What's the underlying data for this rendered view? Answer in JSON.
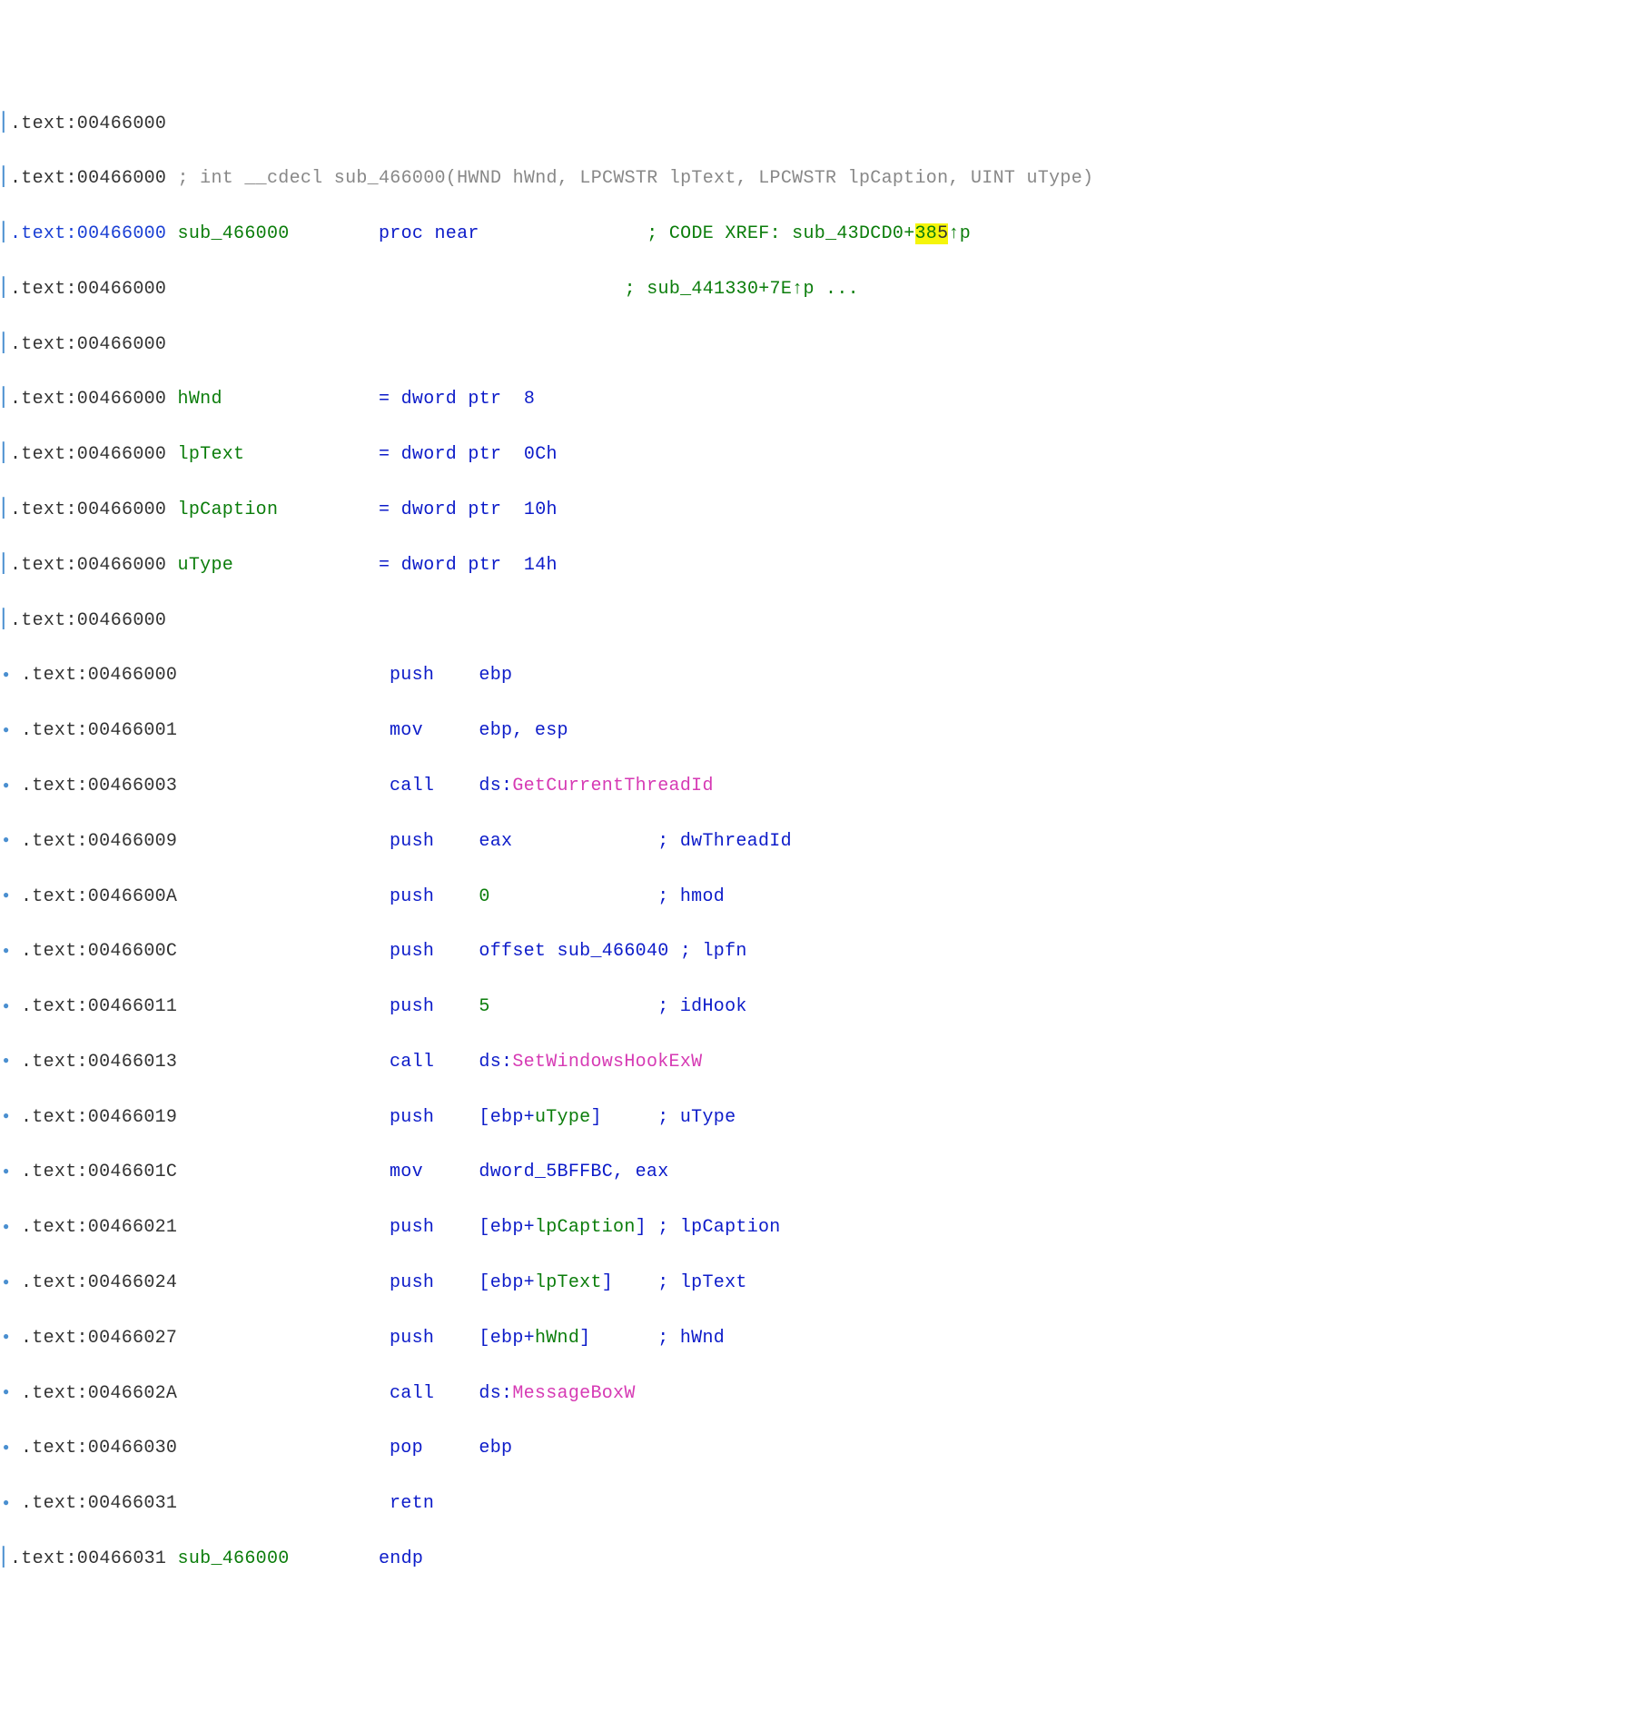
{
  "lines": {
    "l0": {
      "addr": ".text:00466000"
    },
    "l1": {
      "addr": ".text:00466000",
      "cmt": "; int __cdecl sub_466000(HWND hWnd, LPCWSTR lpText, LPCWSTR lpCaption, UINT uType)"
    },
    "l2": {
      "addr": ".text:00466000",
      "name": "sub_466000",
      "proc": "proc near",
      "xref_p": "; CODE XREF: sub_43DCD0+",
      "xref_h1": "38",
      "xref_h2": "5",
      "xref_s": "↑p"
    },
    "l3": {
      "addr": ".text:00466000",
      "xref": "; sub_441330+7E↑p ..."
    },
    "l4": {
      "addr": ".text:00466000"
    },
    "l5": {
      "addr": ".text:00466000",
      "var": "hWnd",
      "eq": "= dword ptr  8"
    },
    "l6": {
      "addr": ".text:00466000",
      "var": "lpText",
      "eq": "= dword ptr  0Ch"
    },
    "l7": {
      "addr": ".text:00466000",
      "var": "lpCaption",
      "eq": "= dword ptr  10h"
    },
    "l8": {
      "addr": ".text:00466000",
      "var": "uType",
      "eq": "= dword ptr  14h"
    },
    "l9": {
      "addr": ".text:00466000"
    },
    "l10": {
      "addr": ".text:00466000",
      "op": "push",
      "arg1": "ebp"
    },
    "l11": {
      "addr": ".text:00466001",
      "op": "mov",
      "arg1": "ebp, esp"
    },
    "l12": {
      "addr": ".text:00466003",
      "op": "call",
      "pfx": "ds:",
      "api": "GetCurrentThreadId"
    },
    "l13": {
      "addr": ".text:00466009",
      "op": "push",
      "arg1": "eax",
      "c": "; dwThreadId"
    },
    "l14": {
      "addr": ".text:0046600A",
      "op": "push",
      "arg1": "0",
      "c": "; hmod"
    },
    "l15": {
      "addr": ".text:0046600C",
      "op": "push",
      "arg1a": "offset",
      "arg1b": "sub_466040",
      "c": "; lpfn"
    },
    "l16": {
      "addr": ".text:00466011",
      "op": "push",
      "arg1": "5",
      "c": "; idHook"
    },
    "l17": {
      "addr": ".text:00466013",
      "op": "call",
      "pfx": "ds:",
      "api": "SetWindowsHookExW"
    },
    "l18": {
      "addr": ".text:00466019",
      "op": "push",
      "br1": "[ebp+",
      "var": "uType",
      "br2": "]",
      "c": "; uType"
    },
    "l19": {
      "addr": ".text:0046601C",
      "op": "mov",
      "arg1": "dword_5BFFBC, eax"
    },
    "l20": {
      "addr": ".text:00466021",
      "op": "push",
      "br1": "[ebp+",
      "var": "lpCaption",
      "br2": "]",
      "c": "; lpCaption"
    },
    "l21": {
      "addr": ".text:00466024",
      "op": "push",
      "br1": "[ebp+",
      "var": "lpText",
      "br2": "]",
      "c": "; lpText"
    },
    "l22": {
      "addr": ".text:00466027",
      "op": "push",
      "br1": "[ebp+",
      "var": "hWnd",
      "br2": "]",
      "c": "; hWnd"
    },
    "l23": {
      "addr": ".text:0046602A",
      "op": "call",
      "pfx": "ds:",
      "api": "MessageBoxW"
    },
    "l24": {
      "addr": ".text:00466030",
      "op": "pop",
      "arg1": "ebp"
    },
    "l25": {
      "addr": ".text:00466031",
      "op": "retn"
    },
    "l26": {
      "addr": ".text:00466031",
      "name": "sub_466000",
      "proc": "endp"
    }
  }
}
